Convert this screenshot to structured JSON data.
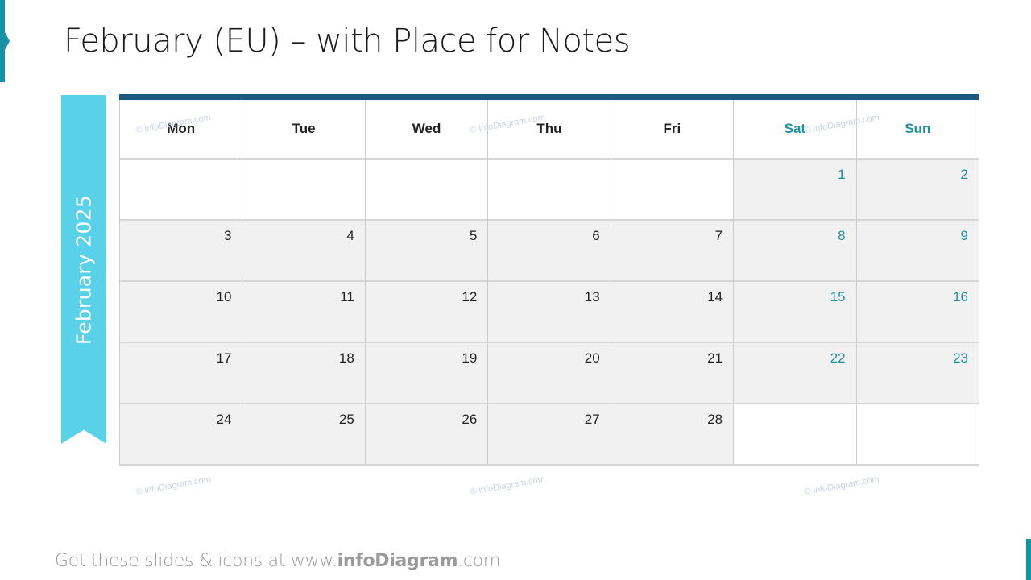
{
  "slide": {
    "title": "February (EU) – with Place for Notes",
    "ribbon_label": "February 2025"
  },
  "calendar": {
    "month": "February",
    "year": "2025",
    "headers": [
      {
        "label": "Mon",
        "weekend": false
      },
      {
        "label": "Tue",
        "weekend": false
      },
      {
        "label": "Wed",
        "weekend": false
      },
      {
        "label": "Thu",
        "weekend": false
      },
      {
        "label": "Fri",
        "weekend": false
      },
      {
        "label": "Sat",
        "weekend": true
      },
      {
        "label": "Sun",
        "weekend": true
      }
    ],
    "weeks": [
      [
        "",
        "",
        "",
        "",
        "",
        "1",
        "2"
      ],
      [
        "3",
        "4",
        "5",
        "6",
        "7",
        "8",
        "9"
      ],
      [
        "10",
        "11",
        "12",
        "13",
        "14",
        "15",
        "16"
      ],
      [
        "17",
        "18",
        "19",
        "20",
        "21",
        "22",
        "23"
      ],
      [
        "24",
        "25",
        "26",
        "27",
        "28",
        "",
        ""
      ]
    ]
  },
  "watermark": "© infoDiagram.com",
  "footer": {
    "prefix": "Get these slides & icons at www.",
    "brand": "infoDiagram",
    "suffix": ".com"
  },
  "colors": {
    "accent": "#1593a6",
    "ribbon": "#59d1e8",
    "header_bar": "#1b5a80",
    "weekend_text": "#1d8fa3",
    "cell_fill": "#f1f1f1"
  }
}
